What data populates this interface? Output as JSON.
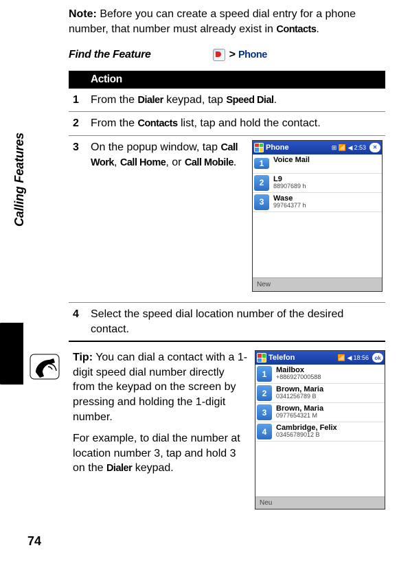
{
  "page_number": "74",
  "margin_label": "Calling Features",
  "note": {
    "label": "Note:",
    "text_a": " Before you can create a speed dial entry for a phone number, that number must already exist in ",
    "contacts": "Contacts",
    "text_b": "."
  },
  "find_feature": {
    "label": "Find the Feature",
    "gt": ">",
    "phone": "Phone"
  },
  "action": {
    "header": "Action",
    "steps": {
      "1": {
        "n": "1",
        "a": "From the ",
        "b": "Dialer",
        "c": " keypad, tap ",
        "d": "Speed Dial",
        "e": "."
      },
      "2": {
        "n": "2",
        "a": "From the ",
        "b": "Contacts",
        "c": " list, tap and hold the contact."
      },
      "3": {
        "n": "3",
        "a": "On the popup window, tap ",
        "b": "Call Work",
        "c": ", ",
        "d": "Call Home",
        "e": ", or ",
        "f": "Call Mobile",
        "g": "."
      },
      "4": {
        "n": "4",
        "a": "Select the speed dial location number of the desired contact."
      }
    }
  },
  "screenshot1": {
    "app": "Phone",
    "clock": "2:53",
    "items": {
      "1": {
        "num": "1",
        "name": "Voice Mail",
        "sub": ""
      },
      "2": {
        "num": "2",
        "name": "L9",
        "sub": "88907689 h"
      },
      "3": {
        "num": "3",
        "name": "Wase",
        "sub": "99764377 h"
      }
    },
    "soft": "New"
  },
  "tip": {
    "label": "Tip:",
    "text_a": " You can dial a contact with a 1-digit speed dial number directly from the keypad on the screen by pressing and holding the 1-digit number.",
    "text_b_a": "For example, to dial the number at location number 3, tap and hold 3 on the ",
    "text_b_dialer": "Dialer",
    "text_b_b": " keypad."
  },
  "screenshot2": {
    "app": "Telefon",
    "clock": "18:56",
    "ok": "ok",
    "items": {
      "1": {
        "num": "1",
        "name": "Mailbox",
        "sub": "+886927000588"
      },
      "2": {
        "num": "2",
        "name": "Brown, Maria",
        "sub": "0341256789 B"
      },
      "3": {
        "num": "3",
        "name": "Brown, Maria",
        "sub": "0977654321 M"
      },
      "4": {
        "num": "4",
        "name": "Cambridge, Felix",
        "sub": "03456789012 B"
      }
    },
    "soft": "Neu"
  }
}
